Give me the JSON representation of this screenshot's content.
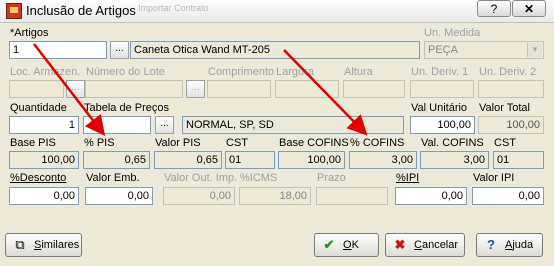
{
  "window": {
    "title": "Inclusão de Artigos",
    "ghost_tab": "Importar Contrato",
    "help_label": "?",
    "close_label": "✕"
  },
  "row1": {
    "artigos_label": "*Artigos",
    "artigos_value": "1",
    "ellipsis": "...",
    "descricao_value": "Caneta Otica Wand MT-205",
    "un_medida_label": "Un. Medida",
    "un_medida_value": "PEÇA"
  },
  "row2": {
    "loc_label": "Loc. Armazen.",
    "lote_label": "Número do Lote",
    "comprimento_label": "Comprimento",
    "largura_label": "Largura",
    "altura_label": "Altura",
    "deriv1_label": "Un. Deriv. 1",
    "deriv2_label": "Un. Deriv. 2"
  },
  "row3": {
    "quantidade_label": "Quantidade",
    "quantidade_value": "1",
    "tabela_label": "Tabela de Preços",
    "tabela_value": "NORMAL, SP, SD",
    "valor_unitario_label": "Val Unitário",
    "valor_unitario_value": "100,00",
    "valor_total_label": "Valor Total",
    "valor_total_value": "100,00"
  },
  "row4": {
    "base_pis_label": "Base PIS",
    "base_pis_value": "100,00",
    "pct_pis_label": "% PIS",
    "pct_pis_value": "0,65",
    "valor_pis_label": "Valor PIS",
    "valor_pis_value": "0,65",
    "cst1_label": "CST",
    "cst1_value": "01",
    "base_cofins_label": "Base COFINS",
    "base_cofins_value": "100,00",
    "pct_cofins_label": "% COFINS",
    "pct_cofins_value": "3,00",
    "valor_cofins_label": "Val. COFINS",
    "valor_cofins_value": "3,00",
    "cst2_label": "CST",
    "cst2_value": "01"
  },
  "row5": {
    "desconto_label": "%Desconto",
    "desconto_value": "0,00",
    "valor_emb_label": "Valor Emb.",
    "valor_emb_value": "0,00",
    "valor_out_label": "Valor Out. Imp.",
    "valor_out_value": "0,00",
    "icms_label": "%ICMS",
    "icms_value": "18,00",
    "prazo_label": "Prazo",
    "ipi_label": "%IPI",
    "ipi_value": "0,00",
    "valor_ipi_label": "Valor IPI",
    "valor_ipi_value": "0,00"
  },
  "buttons": {
    "similares": "Similares",
    "ok": "OK",
    "cancelar": "Cancelar",
    "ajuda": "Ajuda"
  },
  "colors": {
    "annotation_arrow": "#e00000"
  }
}
